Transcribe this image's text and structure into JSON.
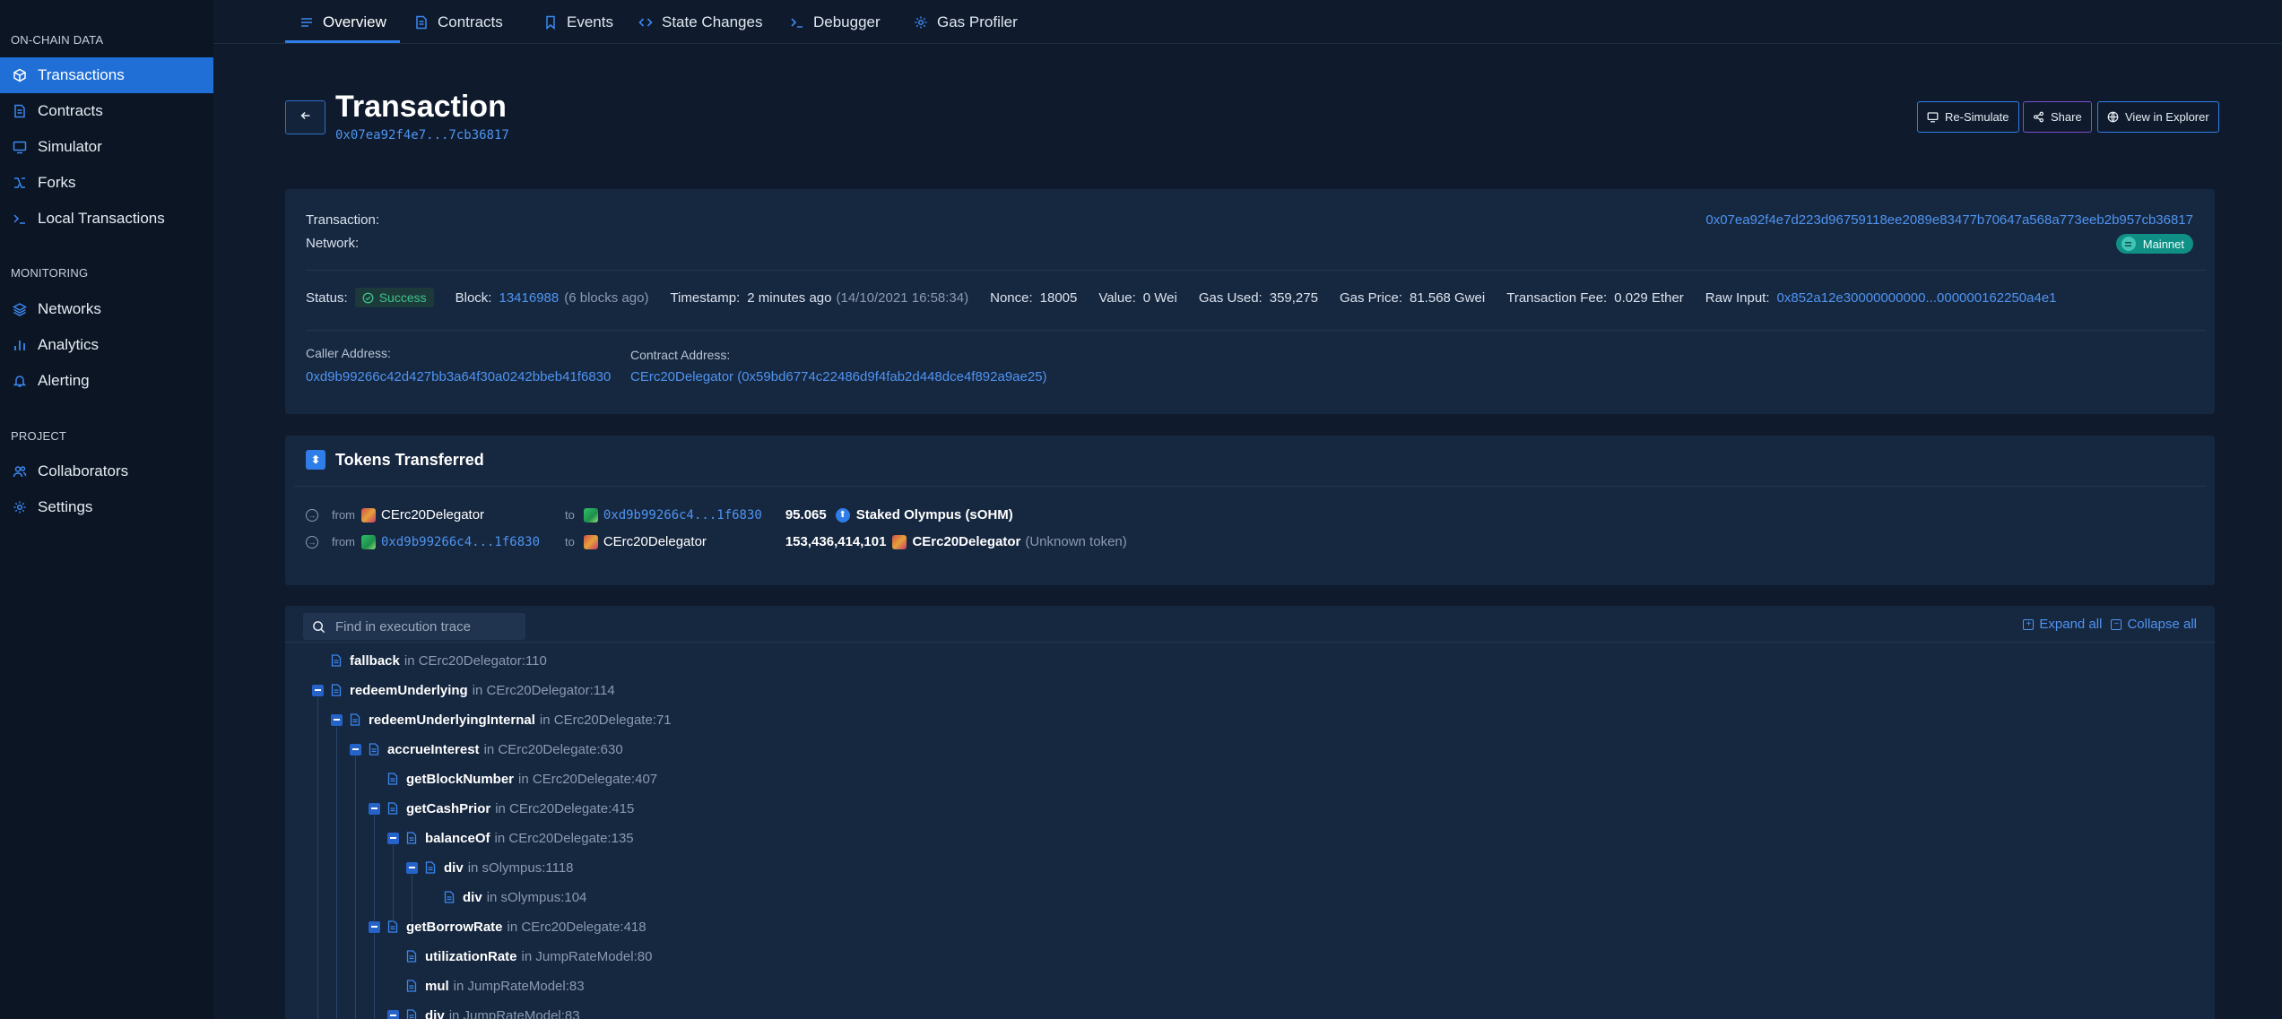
{
  "sidebar": {
    "sections": [
      {
        "title": "ON-CHAIN DATA",
        "items": [
          {
            "label": "Transactions",
            "icon": "transactions-icon",
            "active": true
          },
          {
            "label": "Contracts",
            "icon": "document-icon"
          },
          {
            "label": "Simulator",
            "icon": "monitor-icon"
          },
          {
            "label": "Forks",
            "icon": "fork-icon"
          },
          {
            "label": "Local Transactions",
            "icon": "terminal-icon"
          }
        ]
      },
      {
        "title": "MONITORING",
        "items": [
          {
            "label": "Networks",
            "icon": "layers-icon"
          },
          {
            "label": "Analytics",
            "icon": "bar-chart-icon"
          },
          {
            "label": "Alerting",
            "icon": "bell-icon"
          }
        ]
      },
      {
        "title": "PROJECT",
        "items": [
          {
            "label": "Collaborators",
            "icon": "users-icon"
          },
          {
            "label": "Settings",
            "icon": "gear-icon"
          }
        ]
      }
    ]
  },
  "tabs": [
    {
      "label": "Overview",
      "icon": "list-icon",
      "active": true
    },
    {
      "label": "Contracts",
      "icon": "document-icon"
    },
    {
      "label": "Events",
      "icon": "bookmark-icon"
    },
    {
      "label": "State Changes",
      "icon": "code-icon"
    },
    {
      "label": "Debugger",
      "icon": "terminal-icon"
    },
    {
      "label": "Gas Profiler",
      "icon": "gear-icon"
    }
  ],
  "header": {
    "title": "Transaction",
    "hash_short": "0x07ea92f4e7...7cb36817",
    "buttons": {
      "resimulate": "Re-Simulate",
      "share": "Share",
      "explorer": "View in Explorer"
    }
  },
  "summary": {
    "transaction_label": "Transaction:",
    "transaction_hash": "0x07ea92f4e7d223d96759118ee2089e83477b70647a568a773eeb2b957cb36817",
    "network_label": "Network:",
    "network": "Mainnet",
    "status_label": "Status:",
    "status": "Success",
    "block_label": "Block:",
    "block": "13416988",
    "block_ago": "(6 blocks ago)",
    "timestamp_label": "Timestamp:",
    "timestamp": "2 minutes ago",
    "timestamp_full": "(14/10/2021 16:58:34)",
    "nonce_label": "Nonce:",
    "nonce": "18005",
    "value_label": "Value:",
    "value": "0 Wei",
    "gas_used_label": "Gas Used:",
    "gas_used": "359,275",
    "gas_price_label": "Gas Price:",
    "gas_price": "81.568 Gwei",
    "fee_label": "Transaction Fee:",
    "fee": "0.029 Ether",
    "raw_input_label": "Raw Input:",
    "raw_input": "0x852a12e30000000000...000000162250a4e1",
    "caller_label": "Caller Address:",
    "caller": "0xd9b99266c42d427bb3a64f30a0242bbeb41f6830",
    "contract_label": "Contract Address:",
    "contract": "CErc20Delegator (0x59bd6774c22486d9f4fab2d448dce4f892a9ae25)"
  },
  "tokens": {
    "title": "Tokens Transferred",
    "from_word": "from",
    "to_word": "to",
    "rows": [
      {
        "from": "CErc20Delegator",
        "to": "0xd9b99266c4...1f6830",
        "amount": "95.065",
        "token": "Staked Olympus (sOHM)",
        "note": ""
      },
      {
        "from": "0xd9b99266c4...1f6830",
        "to": "CErc20Delegator",
        "amount": "153,436,414,101",
        "token": "CErc20Delegator",
        "note": "(Unknown token)"
      }
    ]
  },
  "trace": {
    "search_placeholder": "Find in execution trace",
    "expand_all": "Expand all",
    "collapse_all": "Collapse all",
    "in_word": "in",
    "rows": [
      {
        "fn": "fallback",
        "loc": "CErc20Delegator:110",
        "depth": 0,
        "toggle": false
      },
      {
        "fn": "redeemUnderlying",
        "loc": "CErc20Delegator:114",
        "depth": 0,
        "toggle": true
      },
      {
        "fn": "redeemUnderlyingInternal",
        "loc": "CErc20Delegate:71",
        "depth": 1,
        "toggle": true
      },
      {
        "fn": "accrueInterest",
        "loc": "CErc20Delegate:630",
        "depth": 2,
        "toggle": true
      },
      {
        "fn": "getBlockNumber",
        "loc": "CErc20Delegate:407",
        "depth": 3,
        "toggle": false
      },
      {
        "fn": "getCashPrior",
        "loc": "CErc20Delegate:415",
        "depth": 3,
        "toggle": true
      },
      {
        "fn": "balanceOf",
        "loc": "CErc20Delegate:135",
        "depth": 4,
        "toggle": true
      },
      {
        "fn": "div",
        "loc": "sOlympus:1118",
        "depth": 5,
        "toggle": true
      },
      {
        "fn": "div",
        "loc": "sOlympus:104",
        "depth": 6,
        "toggle": false
      },
      {
        "fn": "getBorrowRate",
        "loc": "CErc20Delegate:418",
        "depth": 3,
        "toggle": true
      },
      {
        "fn": "utilizationRate",
        "loc": "JumpRateModel:80",
        "depth": 4,
        "toggle": false
      },
      {
        "fn": "mul",
        "loc": "JumpRateModel:83",
        "depth": 4,
        "toggle": false
      },
      {
        "fn": "div",
        "loc": "JumpRateModel:83",
        "depth": 4,
        "toggle": true
      }
    ]
  },
  "colors": {
    "accent": "#2f7de8",
    "success": "#3ec28a",
    "link": "#4f94f0",
    "background": "#0f1b2d",
    "card": "#162740",
    "sidebar": "#0b1524"
  }
}
